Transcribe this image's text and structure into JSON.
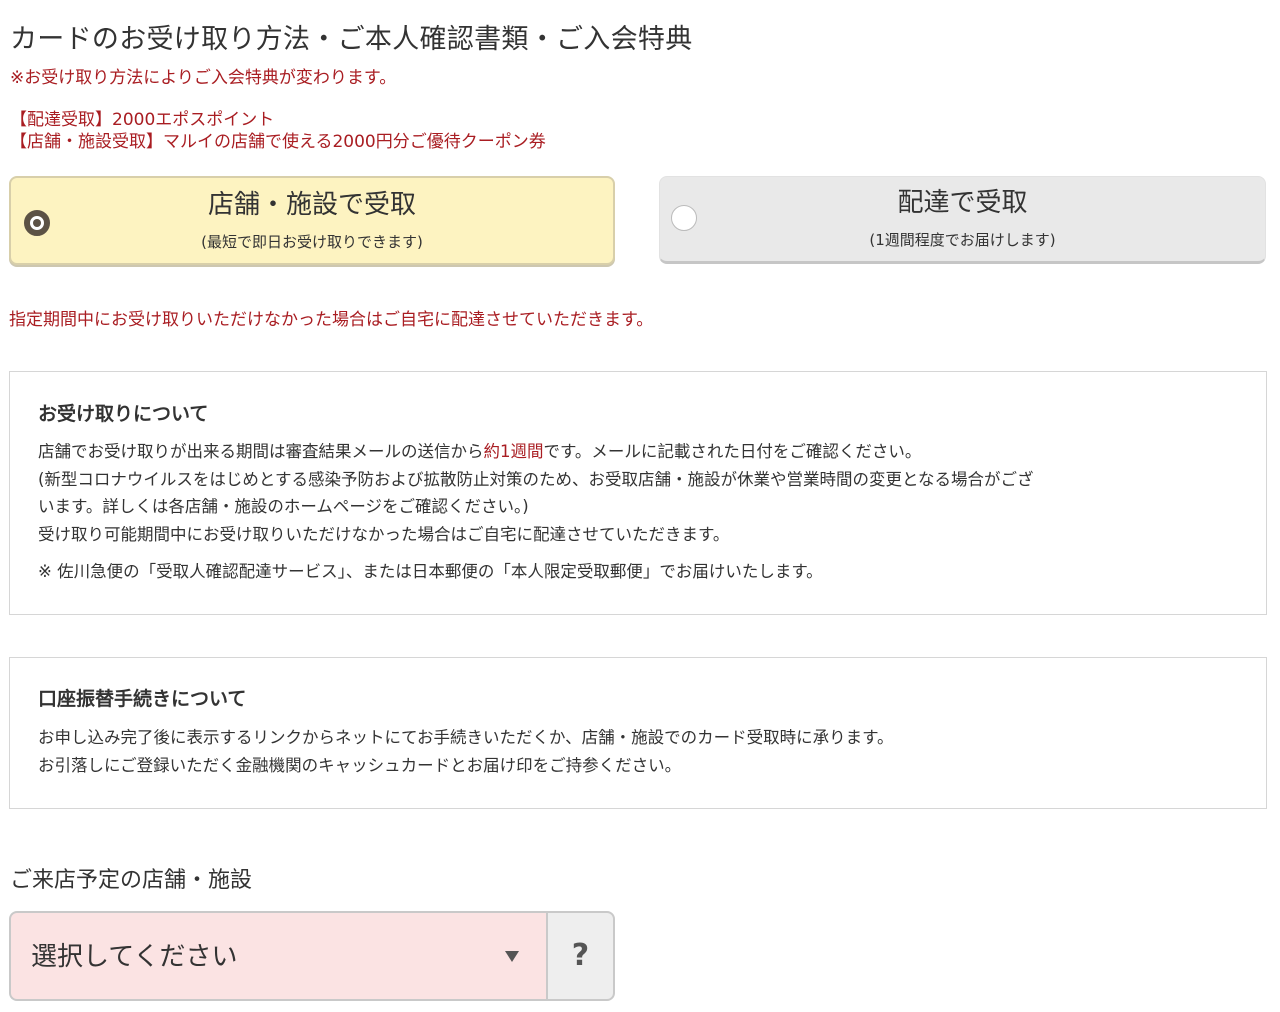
{
  "page": {
    "title": "カードのお受け取り方法・ご本人確認書類・ご入会特典",
    "notice": "※お受け取り方法によりご入会特典が変わります。",
    "benefits": [
      "【配達受取】2000エポスポイント",
      "【店舗・施設受取】マルイの店舗で使える2000円分ご優待クーポン券"
    ]
  },
  "options": {
    "store": {
      "title": "店舗・施設で受取",
      "subtitle": "(最短で即日お受け取りできます)",
      "selected": true
    },
    "delivery": {
      "title": "配達で受取",
      "subtitle": "(1週間程度でお届けします)",
      "selected": false
    }
  },
  "warning": "指定期間中にお受け取りいただけなかった場合はご自宅に配達させていただきます。",
  "receipt_box": {
    "heading": "お受け取りについて",
    "line1_prefix": "店舗でお受け取りが出来る期間は審査結果メールの送信から",
    "line1_highlight": "約1週間",
    "line1_suffix": "です。メールに記載された日付をご確認ください。",
    "covid_line1": "(新型コロナウイルスをはじめとする感染予防および拡散防止対策のため、お受取店舗・施設が休業や営業時間の変更となる場合がござ",
    "covid_line2": "います。詳しくは各店舗・施設のホームページをご確認ください。)",
    "line3": "受け取り可能期間中にお受け取りいただけなかった場合はご自宅に配達させていただきます。",
    "line4": "※ 佐川急便の「受取人確認配達サービス」、または日本郵便の「本人限定受取郵便」でお届けいたします。"
  },
  "transfer_box": {
    "heading": "口座振替手続きについて",
    "line1": "お申し込み完了後に表示するリンクからネットにてお手続きいただくか、店舗・施設でのカード受取時に承ります。",
    "line2": "お引落しにご登録いただく金融機関のキャッシュカードとお届け印をご持参ください。"
  },
  "store_select": {
    "label": "ご来店予定の店舗・施設",
    "value": "選択してください",
    "help": "?"
  },
  "colors": {
    "accent_red": "#a91d22",
    "selected_bg": "#fdf3c1",
    "select_bg": "#fbe3e3"
  }
}
